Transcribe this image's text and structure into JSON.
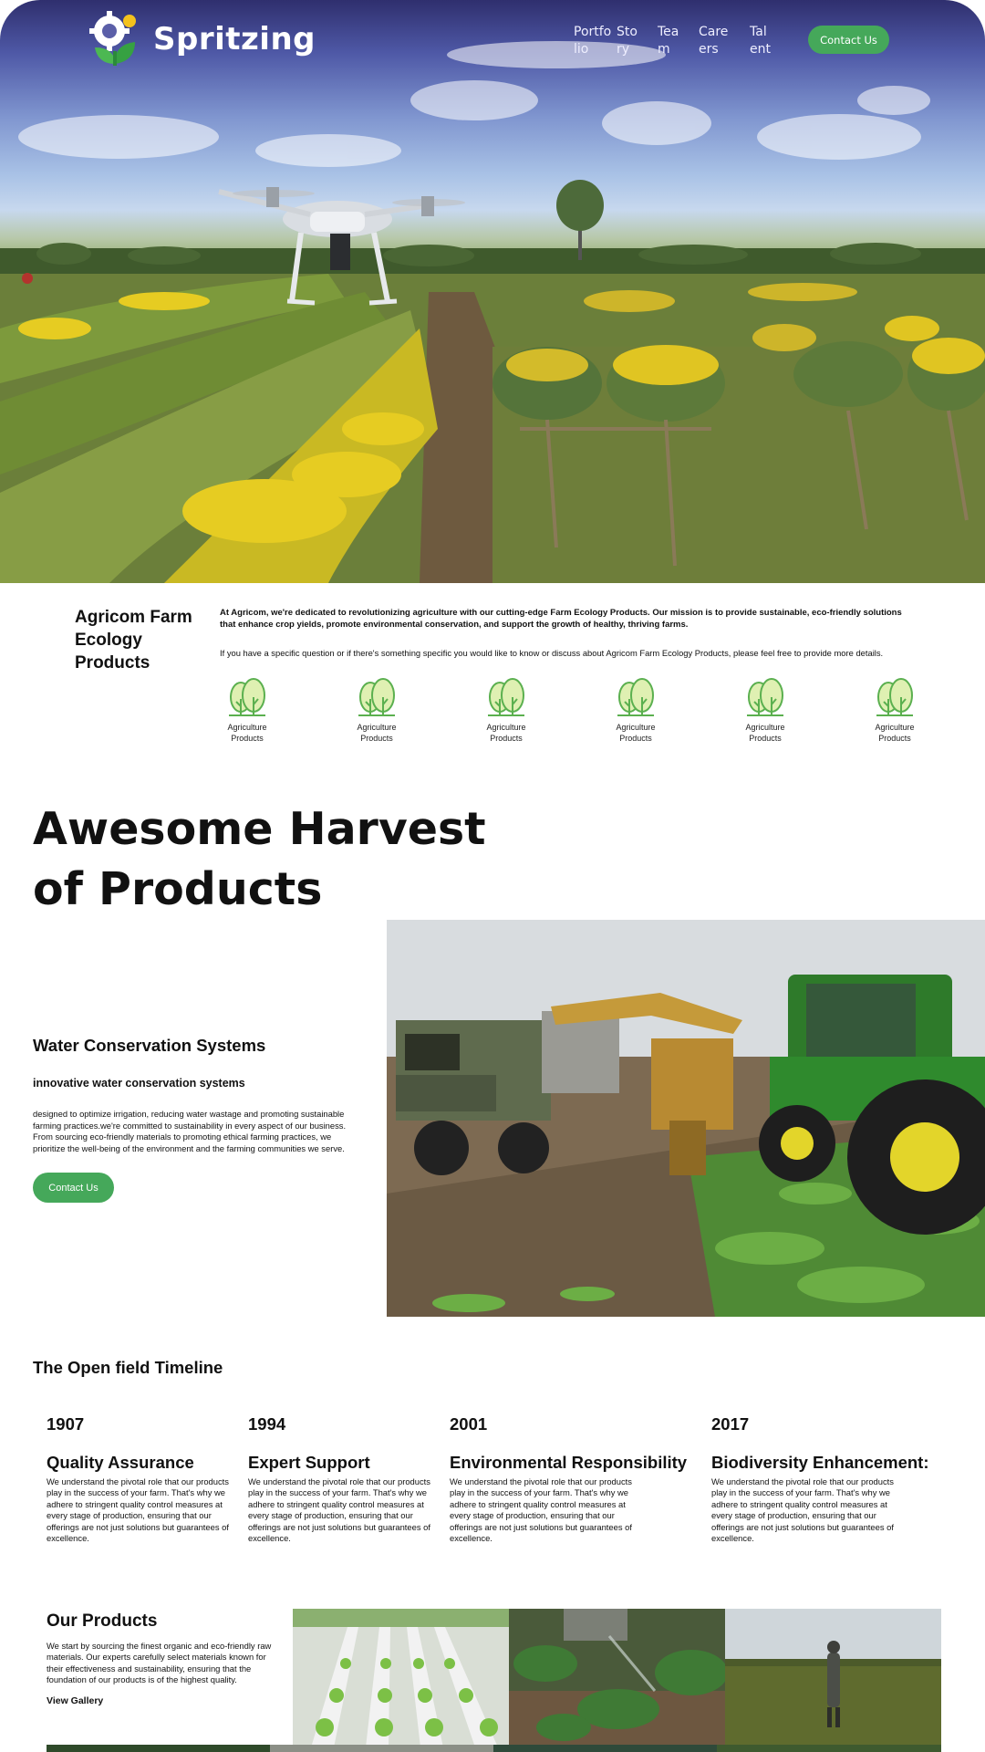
{
  "brand": {
    "name": "Spritzing",
    "accent": "#45a85a"
  },
  "nav": {
    "items": [
      "Portfolio",
      "Story",
      "Team",
      "Careers",
      "Talent"
    ],
    "items_display": [
      "Portfo lio",
      "Sto ry",
      "Tea m",
      "Care ers",
      "Tal ent"
    ],
    "contact_label": "Contact Us"
  },
  "intro": {
    "title": "Agricom Farm Ecology Products",
    "lead": "At Agricom, we're dedicated to revolutionizing agriculture with our cutting-edge Farm Ecology Products. Our mission is to provide sustainable, eco-friendly solutions that enhance crop yields, promote environmental conservation, and support the growth of healthy, thriving farms.",
    "text": "If you have a specific question or if there's something specific you would like to know or discuss about Agricom Farm Ecology Products, please feel free to provide more details.",
    "icons": [
      {
        "icon": "tree-icon",
        "label": "Agriculture Products"
      },
      {
        "icon": "tree-icon",
        "label": "Agriculture Products"
      },
      {
        "icon": "tree-icon",
        "label": "Agriculture Products"
      },
      {
        "icon": "tree-icon",
        "label": "Agriculture Products"
      },
      {
        "icon": "tree-icon",
        "label": "Agriculture Products"
      },
      {
        "icon": "tree-icon",
        "label": "Agriculture Products"
      }
    ]
  },
  "harvest": {
    "title": "Awesome Harvest of Products",
    "feature_title": "Water Conservation Systems",
    "feature_subtitle": "innovative water conservation systems",
    "feature_text": "designed to optimize irrigation, reducing water wastage and promoting sustainable farming practices.we're committed to sustainability in every aspect of our business. From sourcing eco-friendly materials to promoting ethical farming practices, we prioritize the well-being of the environment and the farming communities we serve.",
    "contact_label": "Contact Us"
  },
  "timeline": {
    "title": "The Open field Timeline",
    "entries": [
      {
        "year": "1907",
        "heading": "Quality Assurance",
        "text": "We understand the pivotal role that our products play in the success of your farm. That's why we adhere to stringent quality control measures at every stage of production, ensuring that our offerings are not just solutions but guarantees of excellence."
      },
      {
        "year": "1994",
        "heading": "Expert Support",
        "text": "We understand the pivotal role that our products play in the success of your farm. That's why we adhere to stringent quality control measures at every stage of production, ensuring that our offerings are not just solutions but guarantees of excellence."
      },
      {
        "year": "2001",
        "heading": "Environmental Responsibility",
        "text": "We understand the pivotal role that our products play in the success of your farm. That's why we adhere to stringent quality control measures at every stage of production, ensuring that our offerings are not just solutions but guarantees of excellence."
      },
      {
        "year": "2017",
        "heading": "Biodiversity Enhancement:",
        "text": "We understand the pivotal role that our products play in the success of your farm. That's why we adhere to stringent quality control measures at every stage of production, ensuring that our offerings are not just solutions but guarantees of excellence."
      }
    ]
  },
  "products": {
    "title": "Our Products",
    "text": "We start by sourcing the finest organic and eco-friendly raw materials. Our experts carefully select materials known for their effectiveness and sustainability, ensuring that the foundation of our products is of the highest quality.",
    "link_label": "View Gallery"
  }
}
